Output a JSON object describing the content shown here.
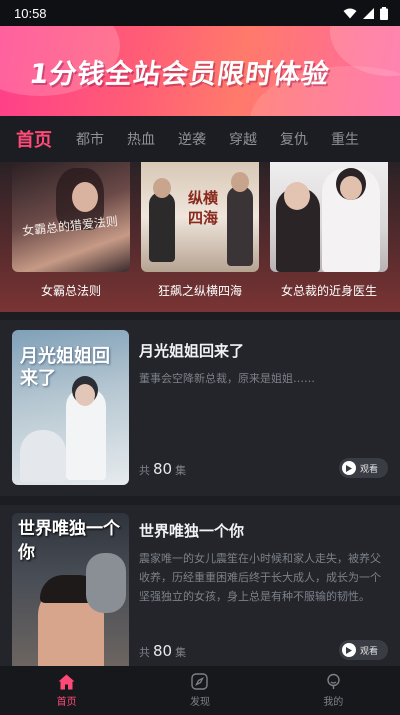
{
  "status_bar": {
    "time": "10:58"
  },
  "banner": {
    "text": "1分钱全站会员限时体验"
  },
  "category_tabs": [
    "首页",
    "都市",
    "热血",
    "逆袭",
    "穿越",
    "复仇",
    "重生"
  ],
  "featured": [
    {
      "title": "女霸总法则",
      "poster_text": "女霸总的猎爱法则"
    },
    {
      "title": "狂飙之纵横四海",
      "poster_text": "纵横四海"
    },
    {
      "title": "女总裁的近身医生",
      "poster_text": ""
    }
  ],
  "dramas": [
    {
      "title": "月光姐姐回来了",
      "description": "董事会空降新总裁，原来是姐姐……",
      "episodes_prefix": "共",
      "episodes": "80",
      "episodes_suffix": "集",
      "watch_label": "观看",
      "poster_text": "月光姐姐回来了"
    },
    {
      "title": "世界唯独一个你",
      "description": "震家唯一的女儿震笙在小时候和家人走失，被养父收养，历经重重困难后终于长大成人，成长为一个坚强独立的女孩，身上总是有种不服输的韧性。",
      "episodes_prefix": "共",
      "episodes": "80",
      "episodes_suffix": "集",
      "watch_label": "观看",
      "poster_text": "世界唯独一个你"
    }
  ],
  "bottom_nav": [
    {
      "label": "首页",
      "icon": "home-icon"
    },
    {
      "label": "发现",
      "icon": "compass-icon"
    },
    {
      "label": "我的",
      "icon": "profile-icon"
    }
  ],
  "colors": {
    "accent": "#ff4a77",
    "background": "#1b1d22",
    "card": "#23252b"
  }
}
